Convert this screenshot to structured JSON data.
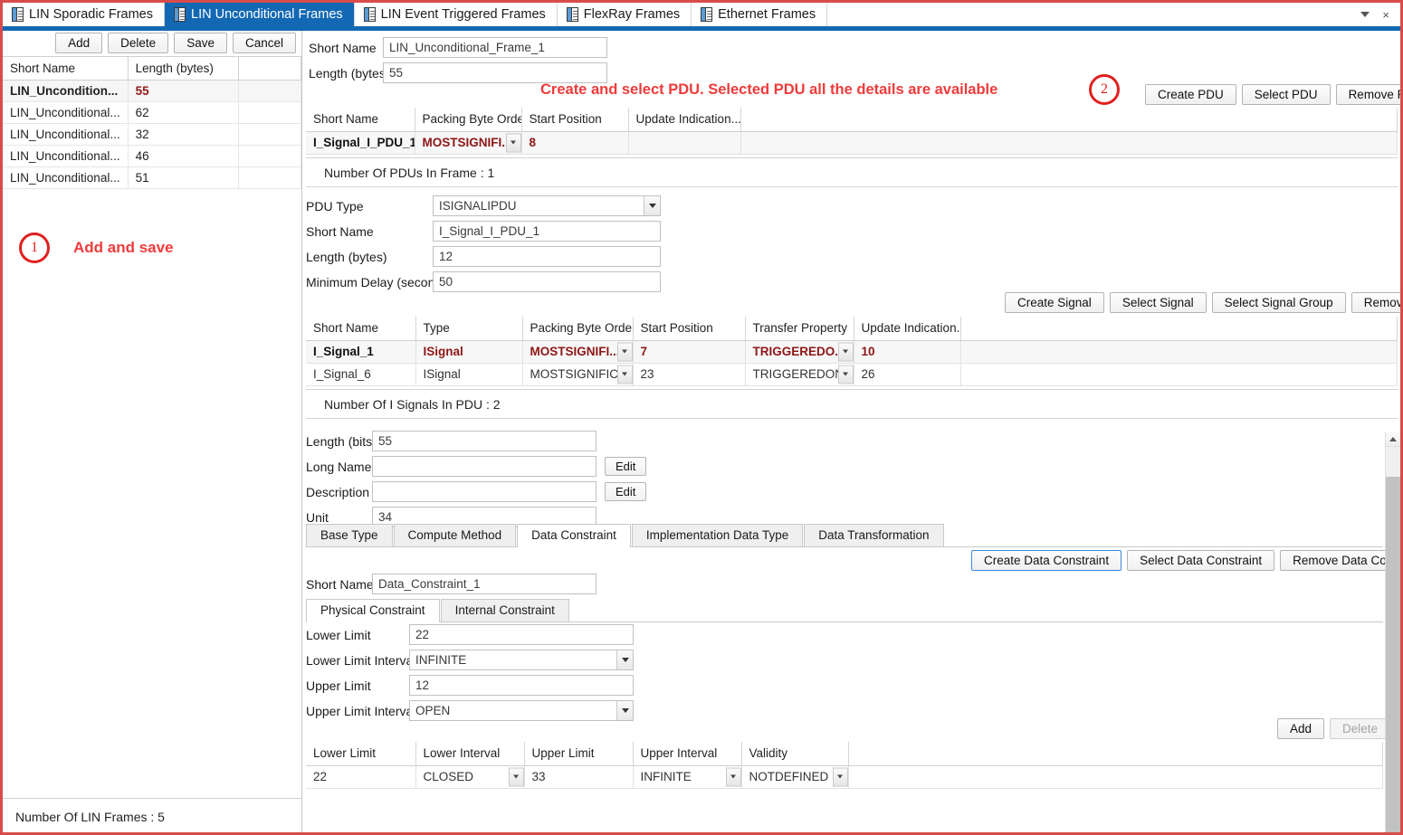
{
  "window": {
    "accent_blue": "#1268b3",
    "annotation_red": "#ef3b3b",
    "value_red": "#8d1616"
  },
  "tabbar": {
    "tabs": [
      {
        "label": "LIN Sporadic Frames",
        "active": false
      },
      {
        "label": "LIN Unconditional Frames",
        "active": true
      },
      {
        "label": "LIN Event Triggered Frames",
        "active": false
      },
      {
        "label": "FlexRay Frames",
        "active": false
      },
      {
        "label": "Ethernet Frames",
        "active": false
      }
    ],
    "overflow_icon": "chevron-down-icon",
    "close_icon": "close-icon",
    "close_glyph": "×"
  },
  "left_panel": {
    "toolbar": {
      "add": "Add",
      "delete": "Delete",
      "save": "Save",
      "cancel": "Cancel"
    },
    "grid": {
      "columns": [
        "Short Name",
        "Length (bytes)",
        ""
      ],
      "rows": [
        {
          "short_name": "LIN_Uncondition...",
          "length": "55",
          "extra": "",
          "selected": true
        },
        {
          "short_name": "LIN_Unconditional...",
          "length": "62",
          "extra": "",
          "selected": false
        },
        {
          "short_name": "LIN_Unconditional...",
          "length": "32",
          "extra": "",
          "selected": false
        },
        {
          "short_name": "LIN_Unconditional...",
          "length": "46",
          "extra": "",
          "selected": false
        },
        {
          "short_name": "LIN_Unconditional...",
          "length": "51",
          "extra": "",
          "selected": false
        }
      ]
    },
    "annotation": {
      "number": "1",
      "text": "Add and save"
    },
    "status": "Number Of LIN Frames : 5"
  },
  "frame": {
    "short_name_label": "Short Name",
    "short_name_value": "LIN_Unconditional_Frame_1",
    "length_label": "Length (bytes)",
    "length_value": "55",
    "annotation": {
      "number": "2",
      "text": "Create and select PDU. Selected PDU all the details are available"
    },
    "buttons": {
      "create": "Create PDU",
      "select": "Select PDU",
      "remove": "Remove PDU"
    }
  },
  "pdu_grid": {
    "columns": [
      "Short Name",
      "Packing Byte Order",
      "Start Position",
      "Update Indication...",
      ""
    ],
    "rows": [
      {
        "short_name": "I_Signal_I_PDU_1",
        "packing_byte_order": "MOSTSIGNIFI...",
        "start_position": "8",
        "update_indication": "",
        "extra": "",
        "selected": true
      }
    ],
    "summary": "Number Of PDUs In Frame : 1"
  },
  "pdu_form": {
    "pdu_type_label": "PDU Type",
    "pdu_type_value": "ISIGNALIPDU",
    "short_name_label": "Short Name",
    "short_name_value": "I_Signal_I_PDU_1",
    "length_label": "Length (bytes)",
    "length_value": "12",
    "min_delay_label": "Minimum Delay (seconds)",
    "min_delay_value": "50"
  },
  "signal_buttons": {
    "create": "Create Signal",
    "select": "Select Signal",
    "select_group": "Select Signal Group",
    "remove": "Remove Signal"
  },
  "signal_grid": {
    "columns": [
      "Short Name",
      "Type",
      "Packing Byte Order",
      "Start Position",
      "Transfer Property",
      "Update Indication...",
      ""
    ],
    "rows": [
      {
        "short_name": "I_Signal_1",
        "type": "ISignal",
        "packing_byte_order": "MOSTSIGNIFI...",
        "start_position": "7",
        "transfer_property": "TRIGGEREDO...",
        "update_indication": "10",
        "extra": "",
        "selected": true
      },
      {
        "short_name": "I_Signal_6",
        "type": "ISignal",
        "packing_byte_order": "MOSTSIGNIFIC...",
        "start_position": "23",
        "transfer_property": "TRIGGEREDON...",
        "update_indication": "26",
        "extra": "",
        "selected": false
      }
    ],
    "summary": "Number Of I Signals In PDU : 2"
  },
  "signal_form": {
    "length_label": "Length (bits)",
    "length_value": "55",
    "long_name_label": "Long Name",
    "long_name_value": "",
    "long_name_edit": "Edit",
    "description_label": "Description",
    "description_value": "",
    "description_edit": "Edit",
    "unit_label": "Unit",
    "unit_value": "34"
  },
  "signal_tabs": [
    {
      "label": "Base Type",
      "active": false
    },
    {
      "label": "Compute Method",
      "active": false
    },
    {
      "label": "Data Constraint",
      "active": true
    },
    {
      "label": "Implementation Data Type",
      "active": false
    },
    {
      "label": "Data Transformation",
      "active": false
    }
  ],
  "data_constraint": {
    "buttons": {
      "create": "Create Data Constraint",
      "select": "Select Data Constraint",
      "remove": "Remove Data Constraint"
    },
    "short_name_label": "Short Name",
    "short_name_value": "Data_Constraint_1",
    "tabs": [
      {
        "label": "Physical Constraint",
        "active": true
      },
      {
        "label": "Internal Constraint",
        "active": false
      }
    ],
    "lower_limit_label": "Lower Limit",
    "lower_limit_value": "22",
    "lower_limit_interval_label": "Lower Limit Interval",
    "lower_limit_interval_value": "INFINITE",
    "upper_limit_label": "Upper Limit",
    "upper_limit_value": "12",
    "upper_limit_interval_label": "Upper Limit Interval",
    "upper_limit_interval_value": "OPEN",
    "add_button": "Add",
    "delete_button": "Delete",
    "grid": {
      "columns": [
        "Lower Limit",
        "Lower Interval",
        "Upper Limit",
        "Upper Interval",
        "Validity",
        ""
      ],
      "rows": [
        {
          "lower_limit": "22",
          "lower_interval": "CLOSED",
          "upper_limit": "33",
          "upper_interval": "INFINITE",
          "validity": "NOTDEFINED",
          "extra": ""
        }
      ]
    }
  }
}
